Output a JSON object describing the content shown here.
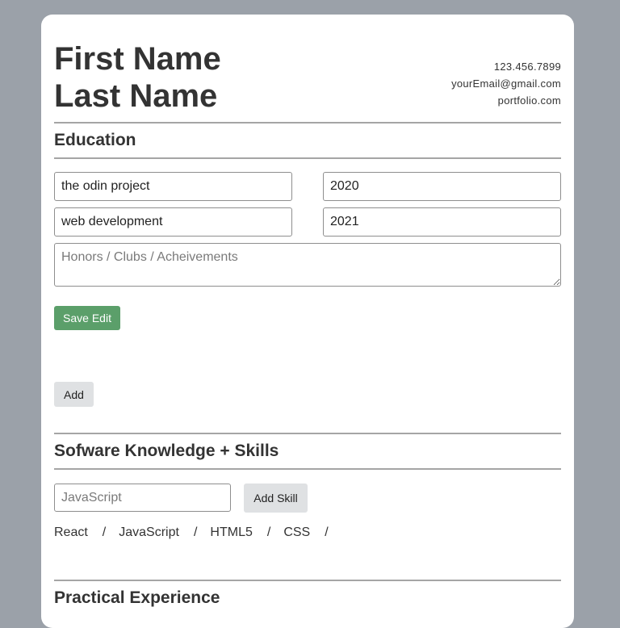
{
  "header": {
    "first_name": "First Name",
    "last_name": "Last Name",
    "phone": "123.456.7899",
    "email": "yourEmail@gmail.com",
    "portfolio": "portfolio.com"
  },
  "education": {
    "title": "Education",
    "school_value": "the odin project",
    "start_year_value": "2020",
    "study_value": "web development",
    "end_year_value": "2021",
    "honors_placeholder": "Honors / Clubs / Acheivements",
    "save_label": "Save Edit",
    "add_label": "Add"
  },
  "skills": {
    "title": "Sofware Knowledge + Skills",
    "input_placeholder": "JavaScript",
    "add_label": "Add Skill",
    "items": [
      "React",
      "JavaScript",
      "HTML5",
      "CSS"
    ],
    "separator": "/"
  },
  "experience": {
    "title": "Practical Experience"
  },
  "colors": {
    "page_background": "#9ba1a9",
    "card_background": "#ffffff",
    "save_button": "#5b9f6a",
    "secondary_button": "#dfe1e3",
    "text": "#333333"
  }
}
